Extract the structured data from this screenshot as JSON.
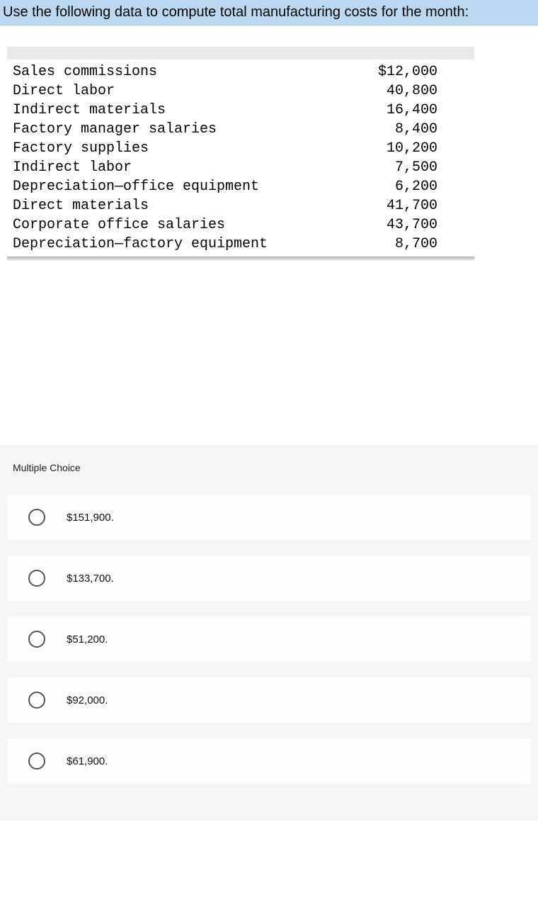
{
  "prompt": "Use the following data to compute total manufacturing costs for the month:",
  "data_rows": [
    {
      "label": "Sales commissions",
      "value": "$12,000"
    },
    {
      "label": "Direct labor",
      "value": "40,800"
    },
    {
      "label": "Indirect materials",
      "value": "16,400"
    },
    {
      "label": "Factory manager salaries",
      "value": "8,400"
    },
    {
      "label": "Factory supplies",
      "value": "10,200"
    },
    {
      "label": "Indirect labor",
      "value": "7,500"
    },
    {
      "label": "Depreciation—office equipment",
      "value": "6,200"
    },
    {
      "label": "Direct materials",
      "value": "41,700"
    },
    {
      "label": "Corporate office salaries",
      "value": "43,700"
    },
    {
      "label": "Depreciation—factory equipment",
      "value": "8,700"
    }
  ],
  "mc_heading": "Multiple Choice",
  "choices": [
    {
      "label": "$151,900."
    },
    {
      "label": "$133,700."
    },
    {
      "label": "$51,200."
    },
    {
      "label": "$92,000."
    },
    {
      "label": "$61,900."
    }
  ]
}
